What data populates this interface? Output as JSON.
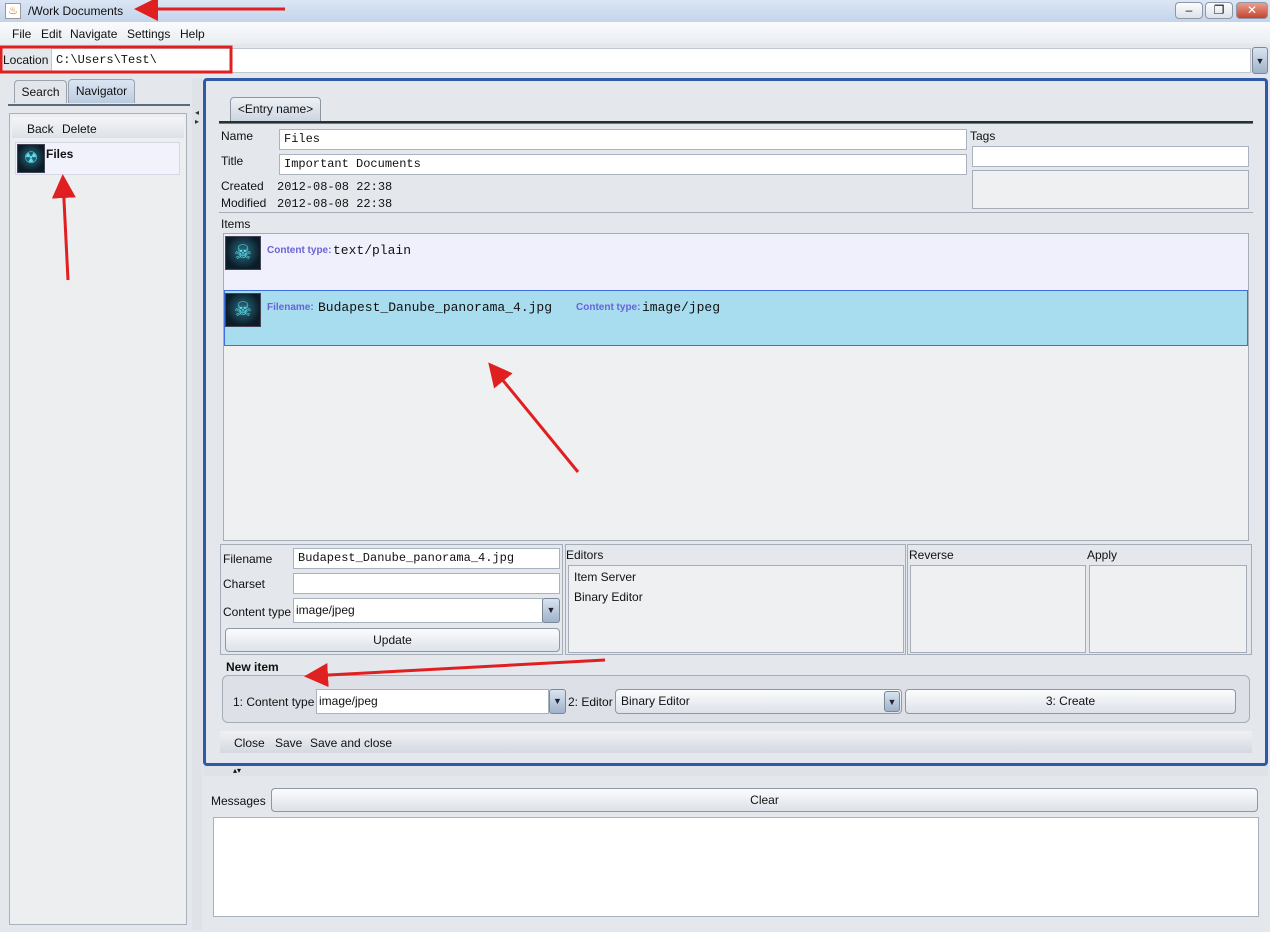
{
  "window": {
    "title": "/Work Documents",
    "controls": [
      "minimize",
      "maximize",
      "close"
    ]
  },
  "menu": [
    "File",
    "Edit",
    "Navigate",
    "Settings",
    "Help"
  ],
  "location": {
    "label": "Location",
    "value": "C:\\Users\\Test\\"
  },
  "left": {
    "tabs": [
      "Search",
      "Navigator"
    ],
    "toolbar": [
      "Back",
      "Delete"
    ],
    "items": [
      {
        "label": "Files",
        "icon": "radiation-icon"
      }
    ]
  },
  "entry": {
    "tab": "<Entry name>",
    "name_label": "Name",
    "name": "Files",
    "title_label": "Title",
    "title": "Important Documents",
    "created_label": "Created",
    "created": "2012-08-08 22:38",
    "modified_label": "Modified",
    "modified": "2012-08-08 22:38",
    "tags_label": "Tags",
    "items_label": "Items",
    "items": [
      {
        "ct_label": "Content type:",
        "ct": "text/plain"
      },
      {
        "fn_label": "Filename:",
        "fn": "Budapest_Danube_panorama_4.jpg",
        "ct_label": "Content type:",
        "ct": "image/jpeg",
        "selected": true
      }
    ]
  },
  "item_details": {
    "filename_label": "Filename",
    "filename": "Budapest_Danube_panorama_4.jpg",
    "charset_label": "Charset",
    "charset": "",
    "ct_label": "Content type",
    "ct": "image/jpeg",
    "update": "Update"
  },
  "editors": {
    "label": "Editors",
    "items": [
      "Item Server",
      "Binary Editor"
    ],
    "reverse_label": "Reverse",
    "apply_label": "Apply"
  },
  "new_item": {
    "label": "New item",
    "ct_label": "1: Content type",
    "ct": "image/jpeg",
    "editor_label": "2: Editor",
    "editor": "Binary Editor",
    "create": "3: Create"
  },
  "bottom_toolbar": [
    "Close",
    "Save",
    "Save and close"
  ],
  "messages": {
    "label": "Messages",
    "clear": "Clear",
    "text": ""
  },
  "colors": {
    "selected_row": "#a8dcef",
    "annotation": "#e02020",
    "frame": "#2f5aa8"
  }
}
